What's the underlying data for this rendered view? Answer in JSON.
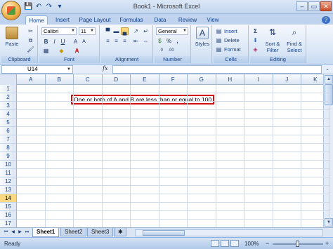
{
  "window": {
    "title": "Book1 - Microsoft Excel"
  },
  "quick_access": [
    {
      "name": "save-icon",
      "glyph": "💾"
    },
    {
      "name": "undo-icon",
      "glyph": "↶"
    },
    {
      "name": "redo-icon",
      "glyph": "↷"
    },
    {
      "name": "customize-qat-icon",
      "glyph": "▾"
    }
  ],
  "tabs": [
    "Home",
    "Insert",
    "Page Layout",
    "Formulas",
    "Data",
    "Review",
    "View"
  ],
  "ribbon": {
    "clipboard": {
      "paste": "Paste",
      "label": "Clipboard"
    },
    "font": {
      "name": "Calibri",
      "size": "11",
      "label": "Font"
    },
    "alignment": {
      "label": "Alignment"
    },
    "number": {
      "format": "General",
      "percent": "%",
      "comma": ",",
      "label": "Number"
    },
    "styles": {
      "button": "Styles"
    },
    "cells": {
      "insert": "Insert",
      "delete": "Delete",
      "format": "Format",
      "label": "Cells"
    },
    "editing": {
      "sigma": "Σ",
      "sort": "Sort &",
      "sort2": "Filter",
      "find": "Find &",
      "find2": "Select",
      "label": "Editing"
    }
  },
  "formula_bar": {
    "name_box": "U14",
    "fx": "fx",
    "value": ""
  },
  "grid": {
    "columns": [
      "A",
      "B",
      "C",
      "D",
      "E",
      "F",
      "G",
      "H",
      "I",
      "J",
      "K"
    ],
    "rows": [
      "1",
      "2",
      "3",
      "4",
      "5",
      "6",
      "7",
      "8",
      "9",
      "10",
      "11",
      "12",
      "13",
      "14",
      "15",
      "16",
      "17"
    ],
    "selected_row": "14",
    "annotation": "One or both of A and B are less than or equal to 100"
  },
  "sheets": [
    "Sheet1",
    "Sheet2",
    "Sheet3"
  ],
  "status": {
    "ready": "Ready",
    "zoom": "100%",
    "zoom_out": "−",
    "zoom_in": "+"
  },
  "colors": {
    "accent": "#15428b",
    "highlight": "#d01212",
    "selected_row": "#f8d881"
  }
}
